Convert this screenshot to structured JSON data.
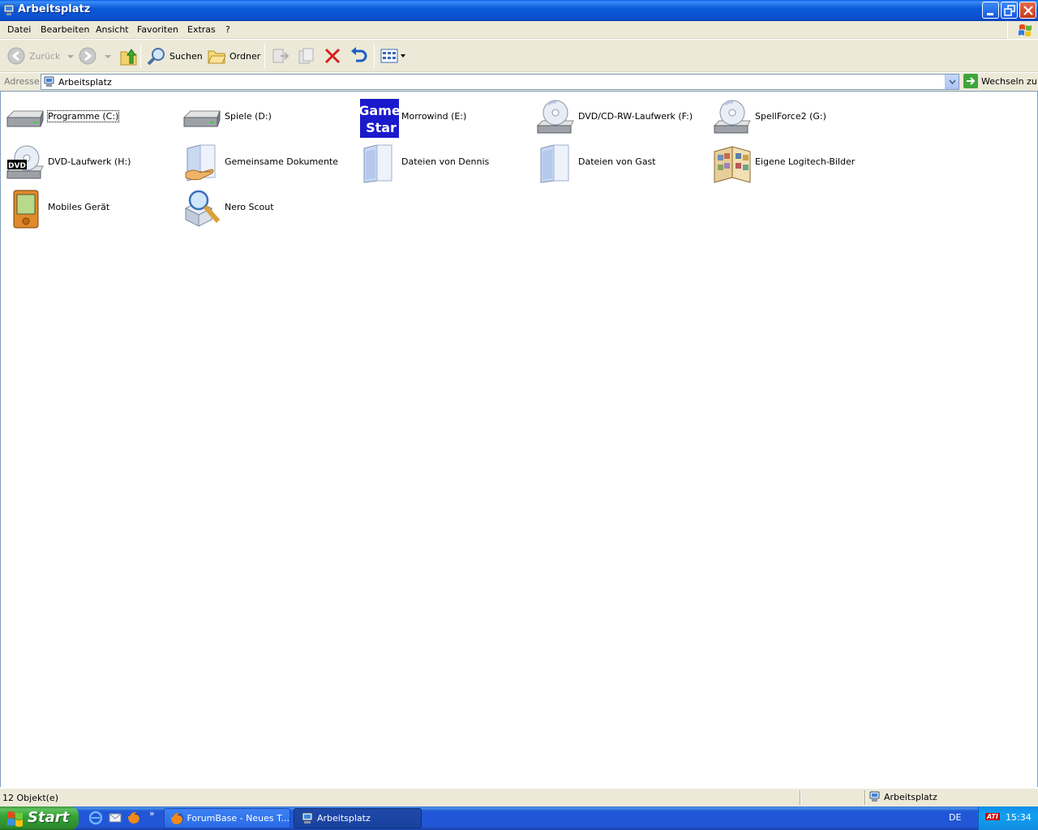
{
  "window": {
    "title": "Arbeitsplatz"
  },
  "menu": [
    "Datei",
    "Bearbeiten",
    "Ansicht",
    "Favoriten",
    "Extras",
    "?"
  ],
  "toolbar": {
    "back_label": "Zurück",
    "search_label": "Suchen",
    "folders_label": "Ordner"
  },
  "address": {
    "label": "Adresse",
    "value": "Arbeitsplatz",
    "go_label": "Wechseln zu"
  },
  "items": [
    {
      "name": "Programme (C:)",
      "icon": "hard-drive-icon"
    },
    {
      "name": "Spiele (D:)",
      "icon": "hard-drive-icon"
    },
    {
      "name": "Morrowind (E:)",
      "icon": "gamestar-cd-icon",
      "icon_text": [
        "Game",
        "Star"
      ]
    },
    {
      "name": "DVD/CD-RW-Laufwerk (F:)",
      "icon": "cd-drive-icon"
    },
    {
      "name": "SpellForce2 (G:)",
      "icon": "cd-drive-icon"
    },
    {
      "name": "DVD-Laufwerk (H:)",
      "icon": "dvd-drive-icon",
      "icon_text": "DVD"
    },
    {
      "name": "Gemeinsame Dokumente",
      "icon": "shared-folder-icon"
    },
    {
      "name": "Dateien von Dennis",
      "icon": "folder-icon"
    },
    {
      "name": "Dateien von Gast",
      "icon": "folder-icon"
    },
    {
      "name": "Eigene Logitech-Bilder",
      "icon": "photo-album-icon"
    },
    {
      "name": "Mobiles Gerät",
      "icon": "mobile-device-icon"
    },
    {
      "name": "Nero Scout",
      "icon": "nero-scout-icon"
    }
  ],
  "status": {
    "count": "12 Objekt(e)",
    "location": "Arbeitsplatz"
  },
  "taskbar": {
    "start_label": "Start",
    "tasks": [
      {
        "label": "ForumBase - Neues T...",
        "active": false
      },
      {
        "label": "Arbeitsplatz",
        "active": true
      }
    ],
    "language": "DE",
    "tray_logo": "ATI",
    "clock": "15:34"
  },
  "colors": {
    "titlebar": "#0a54d8",
    "chrome": "#ece9d8",
    "taskbar": "#2157d7",
    "start": "#36a336"
  }
}
